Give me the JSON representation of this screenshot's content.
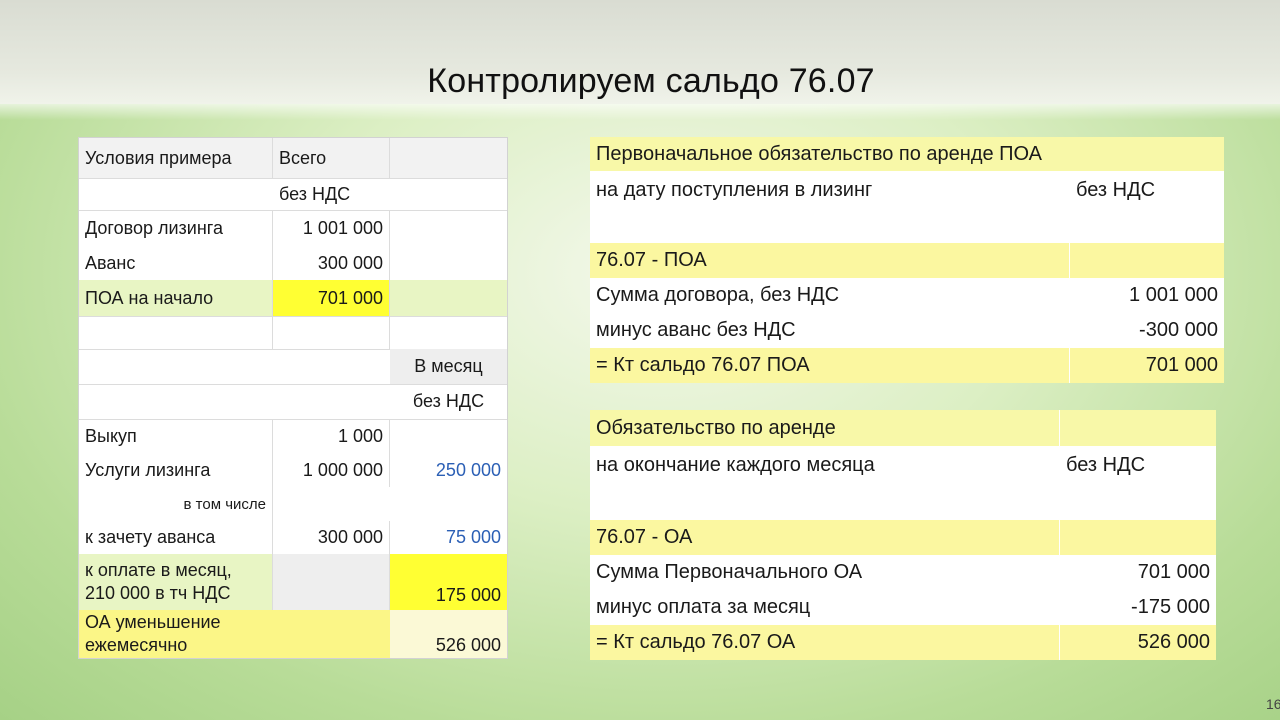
{
  "slide": {
    "title": "Контролируем сальдо 76.07",
    "number": "16"
  },
  "left_table": {
    "header": {
      "c1": "Условия примера",
      "c2": "Всего",
      "c3": ""
    },
    "row_vat1": "без НДС",
    "row_contract": {
      "label": "Договор лизинга",
      "value": "1 001 000"
    },
    "row_advance": {
      "label": "Аванс",
      "value": "300 000"
    },
    "row_poa": {
      "label": "ПОА на начало",
      "value": "701 000"
    },
    "month_header": "В месяц",
    "row_vat2": "без НДС",
    "row_buyout": {
      "label": "Выкуп",
      "value": "1 000"
    },
    "row_services": {
      "label": "Услуги лизинга",
      "total": "1 000 000",
      "month": "250 000"
    },
    "row_including": "в том числе",
    "row_offset": {
      "label": "к зачету аванса",
      "total": "300 000",
      "month": "75 000"
    },
    "row_pay": {
      "label_line1": "к оплате в месяц,",
      "label_line2": "210 000 в тч НДС",
      "month": "175 000"
    },
    "row_oa": {
      "label_line1": "ОА уменьшение",
      "label_line2": "ежемесячно",
      "month": "526 000"
    }
  },
  "box_poa": {
    "title": "Первоначальное обязательство по аренде ПОА",
    "subtitle": "на дату поступления в лизинг",
    "subtitle_right": "без НДС",
    "account": "76.07 - ПОА",
    "rows": [
      {
        "label": "Сумма договора, без НДС",
        "value": "1 001 000"
      },
      {
        "label": "минус аванс без НДС",
        "value": "-300 000"
      },
      {
        "label": "= Кт сальдо 76.07  ПОА",
        "value": "701 000"
      }
    ]
  },
  "box_oa": {
    "title": "Обязательство по аренде",
    "subtitle": "на окончание каждого месяца",
    "subtitle_right": "без НДС",
    "account": "76.07 - ОА",
    "rows": [
      {
        "label": "Сумма Первоначального ОА",
        "value": "701 000"
      },
      {
        "label": "минус оплата за месяц",
        "value": "-175 000"
      },
      {
        "label": "= Кт сальдо 76.07  ОА",
        "value": "526 000"
      }
    ]
  },
  "colors": {
    "highlight_yellow": "#ffff33",
    "row_green": "#e8f5c4",
    "header_yellow": "#f8f8a8",
    "month_blue": "#2b5fb5"
  }
}
